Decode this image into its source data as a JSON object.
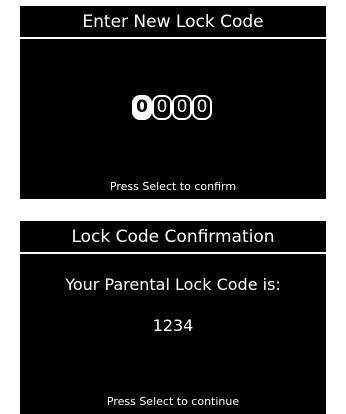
{
  "entry_screen": {
    "title": "Enter New Lock Code",
    "digits": [
      "0",
      "0",
      "0",
      "0"
    ],
    "active_digit_index": 0,
    "hint": "Press Select to confirm"
  },
  "confirmation_screen": {
    "title": "Lock Code Confirmation",
    "message": "Your Parental Lock Code is:",
    "code": "1234",
    "hint": "Press Select to continue"
  },
  "colors": {
    "background": "#000000",
    "foreground": "#ffffff"
  }
}
